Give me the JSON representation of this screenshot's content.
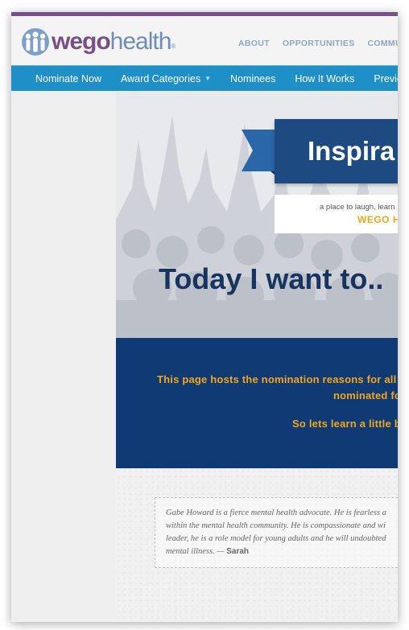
{
  "brand": {
    "name_part1": "wego",
    "name_part2": "health",
    "registered_mark": "®",
    "purple": "#7a4f86",
    "blue": "#6d8db8"
  },
  "top_nav": [
    "ABOUT",
    "OPPORTUNITIES",
    "COMMUNIT"
  ],
  "main_nav": {
    "items": [
      "Nominate Now",
      "Award Categories",
      "Nominees",
      "How It Works",
      "Previous"
    ],
    "dropdown_indicator": "▼",
    "color": "#1f8fc7"
  },
  "hero": {
    "banner_title": "Inspira",
    "subtitle_line1": "a place to laugh, learn",
    "subtitle_line2": "WEGO H",
    "headline": "Today I want to.."
  },
  "info_box": {
    "line1": "This page hosts the nomination reasons for all",
    "line2": "nominated fo",
    "line3": "So lets learn a little b",
    "bg_color": "#103a73",
    "text_color": "#f3a51c"
  },
  "testimonial": {
    "line1": "Gabe Howard is a fierce mental health advocate. He is fearless a",
    "line2": "within the mental health community. He is compassionate and wi",
    "line3": "leader, he is a role model for young adults and he will undoubted",
    "line4": "mental illness. —",
    "author": "Sarah"
  },
  "icons": {
    "logo": "people-logo-icon",
    "caret": "chevron-down-icon"
  }
}
